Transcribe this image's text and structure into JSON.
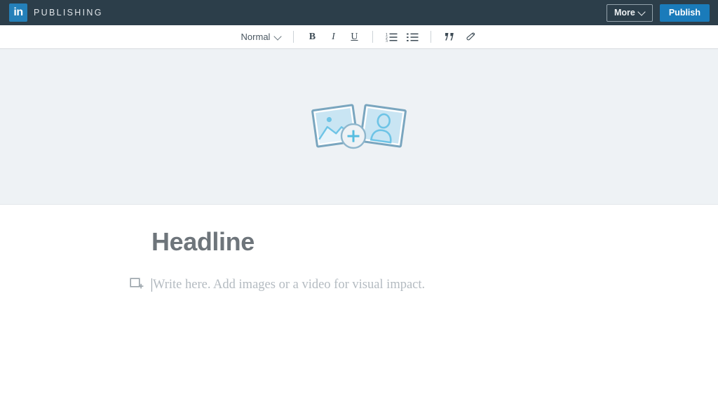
{
  "topbar": {
    "logo_icon": "linkedin-logo-icon",
    "logo_text": "in",
    "brand_word": "PUBLISHING",
    "more_label": "More",
    "more_caret_icon": "chevron-down-icon",
    "publish_label": "Publish",
    "background_color": "#2c3e4a",
    "publish_color": "#1a7bba",
    "logo_color": "#2480b9"
  },
  "toolbar": {
    "style_value": "Normal",
    "style_caret_icon": "chevron-down-icon",
    "bold_label": "B",
    "italic_label": "I",
    "underline_label": "U",
    "bold_icon": "bold-icon",
    "italic_icon": "italic-icon",
    "underline_icon": "underline-icon",
    "ordered_list_icon": "ordered-list-icon",
    "unordered_list_icon": "bullet-list-icon",
    "quote_icon": "blockquote-icon",
    "link_icon": "link-icon"
  },
  "hero": {
    "placeholder_icon": "add-cover-image-icon",
    "background_color": "#eef2f5",
    "art_accent": "#7aa6bf",
    "art_fill": "#c9e5f3",
    "plus_color": "#57bde0"
  },
  "article": {
    "headline_placeholder": "Headline",
    "body_media_icon": "add-media-icon",
    "body_placeholder": "Write here. Add images or a video for visual impact."
  }
}
